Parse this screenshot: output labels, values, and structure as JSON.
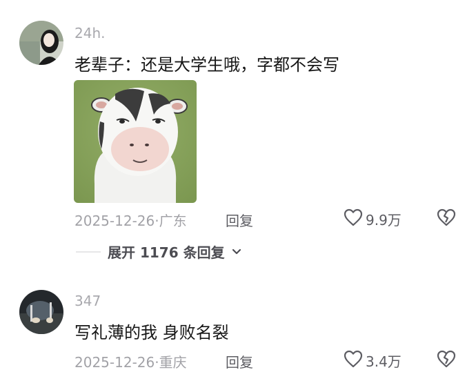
{
  "comments": [
    {
      "username": "24h.",
      "text": "老辈子：还是大学生哦，字都不会写",
      "date_location": "2025-12-26·广东",
      "reply_label": "回复",
      "like_count": "9.9万",
      "expand_label": "展开 1176 条回复"
    },
    {
      "username": "347",
      "text": "写礼薄的我 身败名裂",
      "date_location": "2025-12-26·重庆",
      "reply_label": "回复",
      "like_count": "3.4万"
    }
  ],
  "icons": {
    "like": "heart-outline-icon",
    "dislike": "broken-heart-icon",
    "expand": "chevron-down-icon"
  },
  "colors": {
    "text_primary": "#161616",
    "text_secondary": "#a2a2a7",
    "action_text": "#5c5c62"
  }
}
